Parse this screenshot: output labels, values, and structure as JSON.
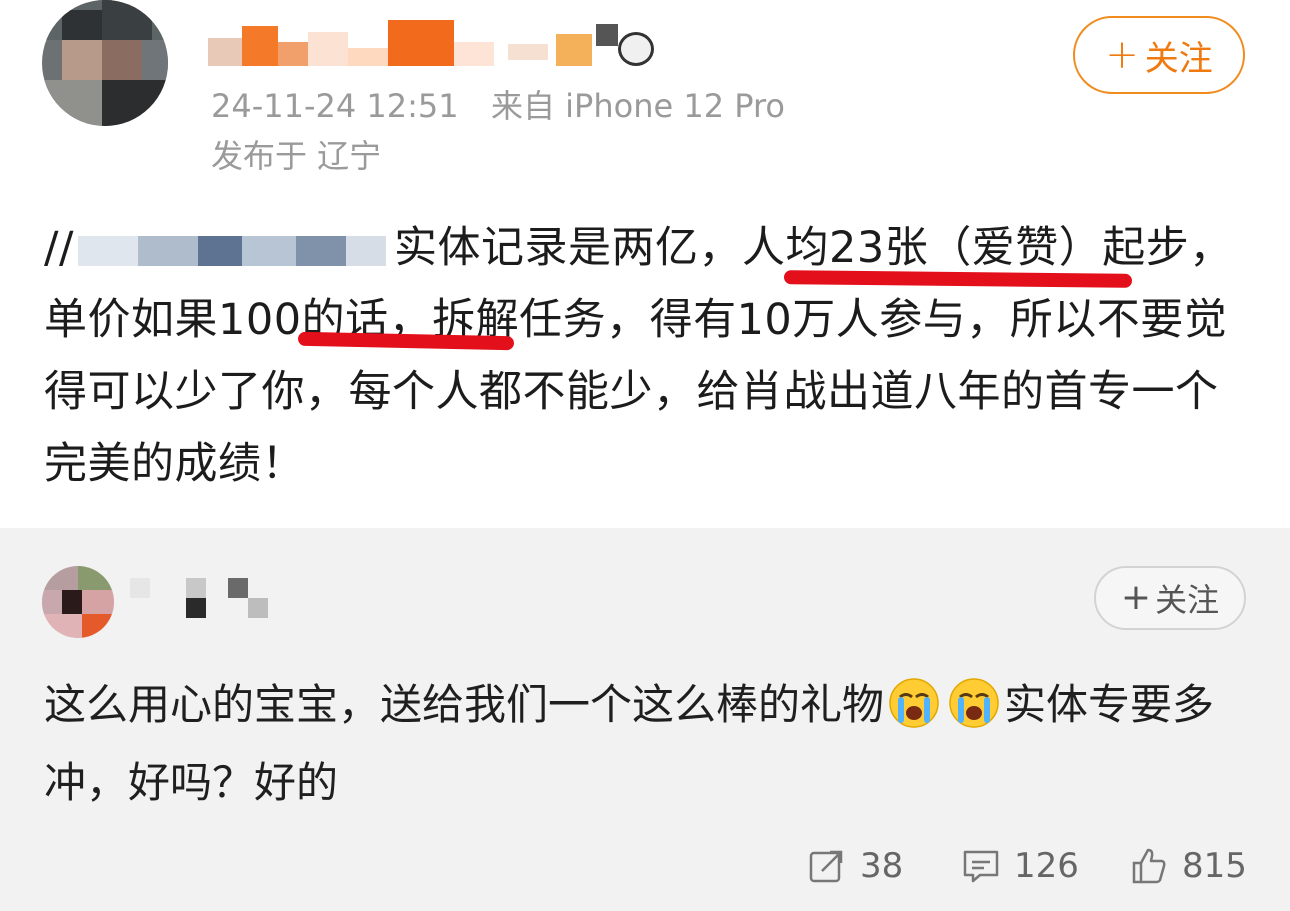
{
  "post": {
    "timestamp": "24-11-24 12:51",
    "source": "来自 iPhone 12 Pro",
    "location": "发布于 辽宁",
    "follow_label": "关注",
    "text_prefix": "//",
    "text_a": "实体记录是两亿，",
    "text_b": "人均23张（爱赞）",
    "text_c": "起步，单价如",
    "text_d": "果100的话",
    "text_e": "，拆解任务，得有10万人参与，所以不要觉得可以少了你，每个人都不能少，给肖战出道八年的首专一个完美的成绩！"
  },
  "comment": {
    "follow_label": "关注",
    "text_a": "这么用心的宝宝，送给我们一个这么棒的礼物",
    "text_b": "实体专要多冲，好吗？好的",
    "emoji_name": "crying-emoji"
  },
  "actions": {
    "repost_count": "38",
    "comment_count": "126",
    "like_count": "815"
  },
  "colors": {
    "accent": "#f07a10",
    "underline": "#e3101c",
    "meta_text": "#9a9a9a",
    "comment_bg": "#f2f2f2"
  }
}
